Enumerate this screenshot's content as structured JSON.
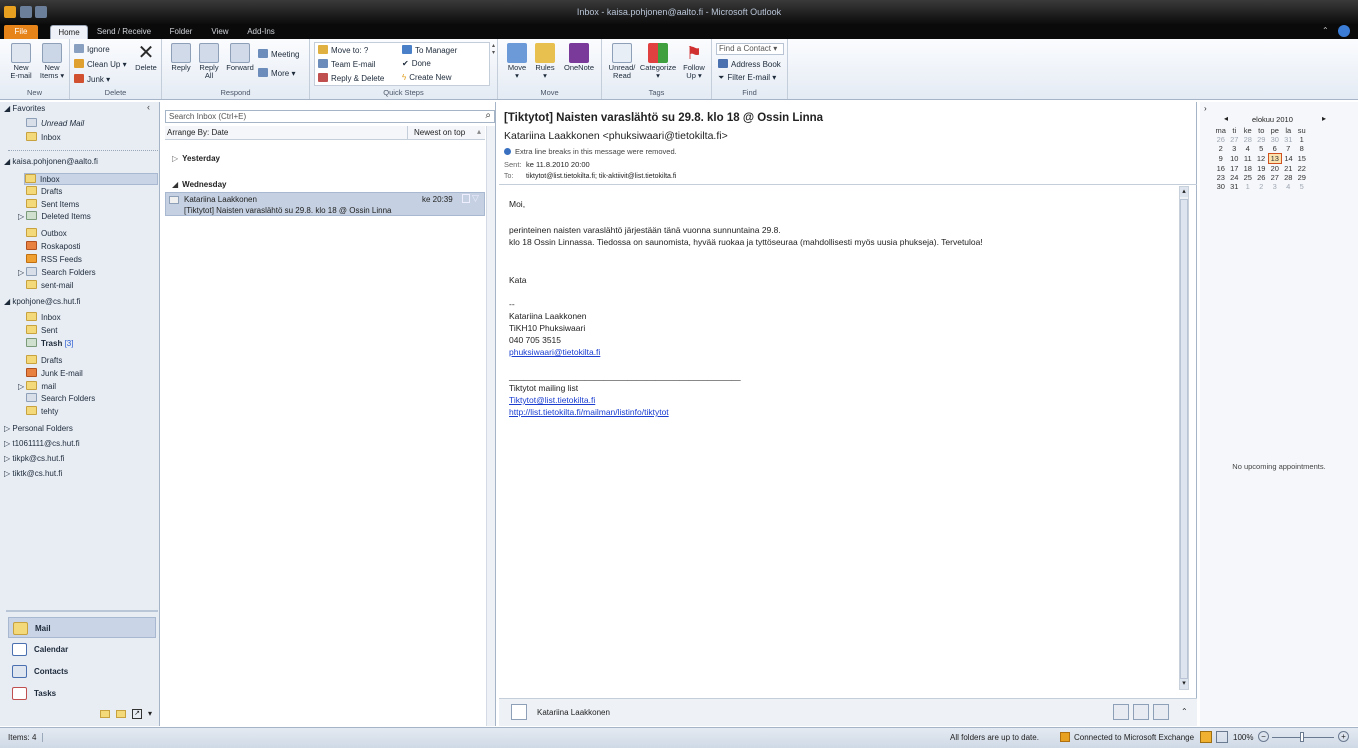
{
  "window": {
    "title": "Inbox - kaisa.pohjonen@aalto.fi - Microsoft Outlook"
  },
  "tabs": [
    "File",
    "Home",
    "Send / Receive",
    "Folder",
    "View",
    "Add-Ins"
  ],
  "ribbon": {
    "new": {
      "label": "New",
      "new_email": "New\nE-mail",
      "new_items": "New\nItems ▾"
    },
    "delete": {
      "label": "Delete",
      "ignore": "Ignore",
      "cleanup": "Clean Up ▾",
      "junk": "Junk ▾",
      "delete": "Delete"
    },
    "respond": {
      "label": "Respond",
      "reply": "Reply",
      "reply_all": "Reply\nAll",
      "forward": "Forward",
      "meeting": "Meeting",
      "more": "More ▾"
    },
    "quicksteps": {
      "label": "Quick Steps",
      "items": [
        "Move to: ?",
        "Team E-mail",
        "Reply & Delete",
        "To Manager",
        "Done",
        "Create New"
      ]
    },
    "move": {
      "label": "Move",
      "move": "Move\n▾",
      "rules": "Rules\n▾",
      "onenote": "OneNote"
    },
    "tags": {
      "label": "Tags",
      "unread": "Unread/\nRead",
      "categorize": "Categorize\n▾",
      "follow": "Follow\nUp ▾"
    },
    "find": {
      "label": "Find",
      "find_contact": "Find a Contact ▾",
      "address_book": "Address Book",
      "filter": "Filter E-mail ▾"
    }
  },
  "nav": {
    "favorites_header": "Favorites",
    "favorites": [
      "Unread Mail",
      "Inbox"
    ],
    "account1": "kaisa.pohjonen@aalto.fi",
    "account1_folders": [
      "Inbox",
      "Drafts",
      "Sent Items",
      "Deleted Items",
      "Outbox",
      "Roskaposti",
      "RSS Feeds",
      "Search Folders",
      "sent-mail"
    ],
    "account2": "kpohjone@cs.hut.fi",
    "account2_folders": [
      "Inbox",
      "Sent",
      "Trash",
      "Drafts",
      "Junk E-mail",
      "mail",
      "Search Folders",
      "tehty"
    ],
    "trash_count": "[3]",
    "others": [
      "Personal Folders",
      "t1061111@cs.hut.fi",
      "tikpk@cs.hut.fi",
      "tiktk@cs.hut.fi"
    ],
    "buttons": [
      "Mail",
      "Calendar",
      "Contacts",
      "Tasks"
    ]
  },
  "list": {
    "search_placeholder": "Search Inbox (Ctrl+E)",
    "arrange": "Arrange By: Date",
    "order": "Newest on top",
    "groups": [
      "Yesterday",
      "Wednesday"
    ],
    "messages": [
      {
        "from": "Katariina Laakkonen",
        "time": "ke 20:39",
        "subject": "[Tiktytot] Naisten varaslähtö su 29.8. klo 18 @ Ossin Linna"
      }
    ]
  },
  "reading": {
    "subject": "[Tiktytot] Naisten varaslähtö su 29.8. klo 18 @ Ossin Linna",
    "from": "Katariina Laakkonen <phuksiwaari@tietokilta.fi>",
    "info": "Extra line breaks in this message were removed.",
    "sent_label": "Sent:",
    "sent": "ke 11.8.2010 20:00",
    "to_label": "To:",
    "to": "tiktytot@list.tietokilta.fi; tik-aktiivit@list.tietokilta.fi",
    "body": [
      "Moi,",
      "perinteinen naisten varaslähtö järjestään tänä vuonna sunnuntaina 29.8.",
      "klo 18 Ossin Linnassa. Tiedossa on saunomista, hyvää ruokaa ja tyttöseuraa (mahdollisesti myös uusia phukseja). Tervetuloa!",
      "Kata",
      "--",
      "Katariina Laakkonen",
      "TiKH10 Phuksiwaari",
      "040 705 3515",
      "phuksiwaari@tietokilta.fi",
      "_________________________________________________",
      "Tiktytot mailing list",
      "Tiktytot@list.tietokilta.fi",
      "http://list.tietokilta.fi/mailman/listinfo/tiktytot"
    ],
    "people_name": "Katariina Laakkonen"
  },
  "todo": {
    "month": "elokuu 2010",
    "days": [
      "ma",
      "ti",
      "ke",
      "to",
      "pe",
      "la",
      "su"
    ],
    "weeks": [
      [
        "26",
        "27",
        "28",
        "29",
        "30",
        "31",
        "1"
      ],
      [
        "2",
        "3",
        "4",
        "5",
        "6",
        "7",
        "8"
      ],
      [
        "9",
        "10",
        "11",
        "12",
        "13",
        "14",
        "15"
      ],
      [
        "16",
        "17",
        "18",
        "19",
        "20",
        "21",
        "22"
      ],
      [
        "23",
        "24",
        "25",
        "26",
        "27",
        "28",
        "29"
      ],
      [
        "30",
        "31",
        "1",
        "2",
        "3",
        "4",
        "5"
      ]
    ],
    "today": "13",
    "no_appointments": "No upcoming appointments."
  },
  "status": {
    "items": "Items: 4",
    "sync": "All folders are up to date.",
    "exchange": "Connected to Microsoft Exchange",
    "zoom": "100%"
  }
}
